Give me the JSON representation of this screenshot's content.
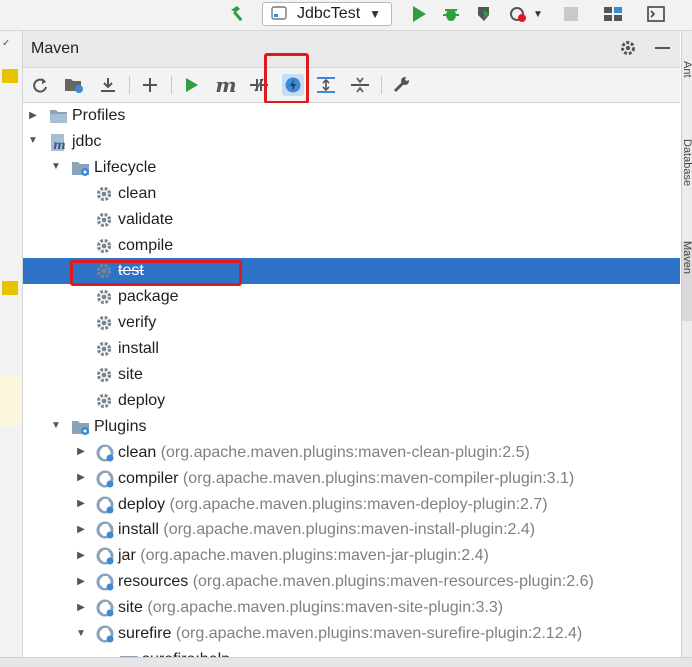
{
  "topbar": {
    "run_config": "JdbcTest",
    "icons": [
      "hammer-icon",
      "run-icon",
      "debug-icon",
      "coverage-icon",
      "profile-icon",
      "stop-icon",
      "project-structure-icon",
      "terminal-icon"
    ]
  },
  "maven": {
    "title": "Maven",
    "toolbar": [
      "reload-icon",
      "add-project-icon",
      "download-icon",
      "add-icon",
      "run-icon",
      "maven-goal-icon",
      "toggle-offline-icon",
      "skip-tests-icon",
      "show-dependencies-icon",
      "collapse-all-icon",
      "settings-wrench-icon"
    ],
    "tree": [
      {
        "id": "profiles",
        "label": "Profiles",
        "detail": "",
        "level": 0,
        "arrow": "right",
        "icon": "folder"
      },
      {
        "id": "jdbc",
        "label": "jdbc",
        "detail": "",
        "level": 0,
        "arrow": "down",
        "icon": "maven"
      },
      {
        "id": "lifecycle",
        "label": "Lifecycle",
        "detail": "",
        "level": 1,
        "arrow": "down",
        "icon": "folder-gear"
      },
      {
        "id": "clean",
        "label": "clean",
        "detail": "",
        "level": 2,
        "arrow": "",
        "icon": "gear"
      },
      {
        "id": "validate",
        "label": "validate",
        "detail": "",
        "level": 2,
        "arrow": "",
        "icon": "gear"
      },
      {
        "id": "compile",
        "label": "compile",
        "detail": "",
        "level": 2,
        "arrow": "",
        "icon": "gear"
      },
      {
        "id": "test",
        "label": "test",
        "detail": "",
        "level": 2,
        "arrow": "",
        "icon": "gear",
        "selected": true
      },
      {
        "id": "package",
        "label": "package",
        "detail": "",
        "level": 2,
        "arrow": "",
        "icon": "gear"
      },
      {
        "id": "verify",
        "label": "verify",
        "detail": "",
        "level": 2,
        "arrow": "",
        "icon": "gear"
      },
      {
        "id": "install",
        "label": "install",
        "detail": "",
        "level": 2,
        "arrow": "",
        "icon": "gear"
      },
      {
        "id": "site",
        "label": "site",
        "detail": "",
        "level": 2,
        "arrow": "",
        "icon": "gear"
      },
      {
        "id": "deploy",
        "label": "deploy",
        "detail": "",
        "level": 2,
        "arrow": "",
        "icon": "gear"
      },
      {
        "id": "plugins",
        "label": "Plugins",
        "detail": "",
        "level": 1,
        "arrow": "down",
        "icon": "folder-gear"
      },
      {
        "id": "plugin-clean",
        "label": "clean",
        "detail": "(org.apache.maven.plugins:maven-clean-plugin:2.5)",
        "level": 2,
        "arrow": "right",
        "icon": "plugin"
      },
      {
        "id": "plugin-compiler",
        "label": "compiler",
        "detail": "(org.apache.maven.plugins:maven-compiler-plugin:3.1)",
        "level": 2,
        "arrow": "right",
        "icon": "plugin"
      },
      {
        "id": "plugin-deploy",
        "label": "deploy",
        "detail": "(org.apache.maven.plugins:maven-deploy-plugin:2.7)",
        "level": 2,
        "arrow": "right",
        "icon": "plugin"
      },
      {
        "id": "plugin-install",
        "label": "install",
        "detail": "(org.apache.maven.plugins:maven-install-plugin:2.4)",
        "level": 2,
        "arrow": "right",
        "icon": "plugin"
      },
      {
        "id": "plugin-jar",
        "label": "jar",
        "detail": "(org.apache.maven.plugins:maven-jar-plugin:2.4)",
        "level": 2,
        "arrow": "right",
        "icon": "plugin"
      },
      {
        "id": "plugin-resources",
        "label": "resources",
        "detail": "(org.apache.maven.plugins:maven-resources-plugin:2.6)",
        "level": 2,
        "arrow": "right",
        "icon": "plugin"
      },
      {
        "id": "plugin-site",
        "label": "site",
        "detail": "(org.apache.maven.plugins:maven-site-plugin:3.3)",
        "level": 2,
        "arrow": "right",
        "icon": "plugin"
      },
      {
        "id": "plugin-surefire",
        "label": "surefire",
        "detail": "(org.apache.maven.plugins:maven-surefire-plugin:2.12.4)",
        "level": 2,
        "arrow": "down",
        "icon": "plugin"
      },
      {
        "id": "surefire-help",
        "label": "surefire:help",
        "detail": "",
        "level": 3,
        "arrow": "",
        "icon": "goal"
      }
    ]
  },
  "side_tabs": [
    "Ant",
    "Database",
    "Maven"
  ],
  "colors": {
    "selection": "#2f73c8",
    "highlight": "#e0191d",
    "run": "#2e9e42",
    "gear": "#7a8592",
    "folder": "#8aa3bb"
  }
}
